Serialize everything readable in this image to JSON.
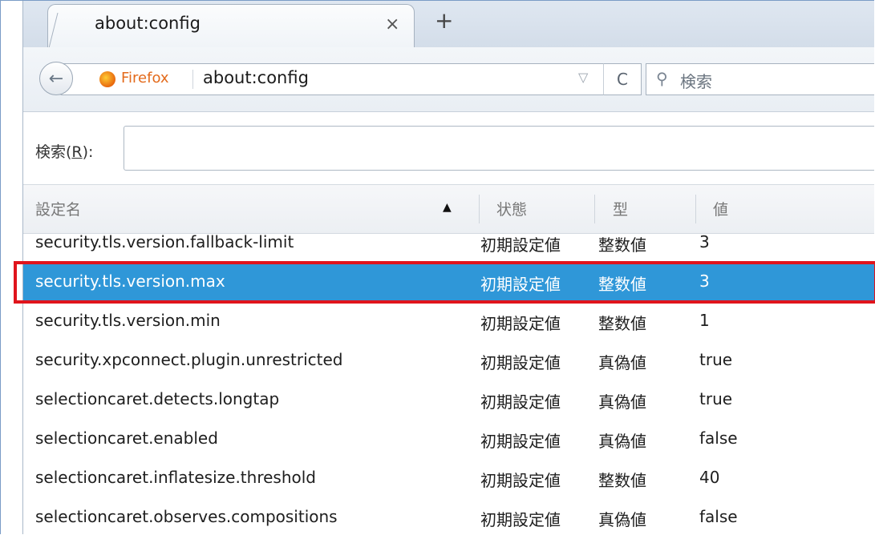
{
  "tab": {
    "title": "about:config",
    "close_glyph": "×",
    "new_tab_glyph": "+"
  },
  "navbar": {
    "back_glyph": "←",
    "identity_label": "Firefox",
    "url": "about:config",
    "dropmarker_glyph": "▽",
    "reload_glyph": "C",
    "search_placeholder": "検索",
    "search_glyph": "⚲"
  },
  "config_search": {
    "label_prefix": "検索(",
    "label_key": "R",
    "label_suffix": "):",
    "value": ""
  },
  "table": {
    "headers": {
      "name": "設定名",
      "status": "状態",
      "type": "型",
      "value": "値"
    },
    "sort_glyph": "▲",
    "rows": [
      {
        "name": "security.tls.version.fallback-limit",
        "status": "初期設定値",
        "type": "整数値",
        "value": "3"
      },
      {
        "name": "security.tls.version.max",
        "status": "初期設定値",
        "type": "整数値",
        "value": "3"
      },
      {
        "name": "security.tls.version.min",
        "status": "初期設定値",
        "type": "整数値",
        "value": "1"
      },
      {
        "name": "security.xpconnect.plugin.unrestricted",
        "status": "初期設定値",
        "type": "真偽値",
        "value": "true"
      },
      {
        "name": "selectioncaret.detects.longtap",
        "status": "初期設定値",
        "type": "真偽値",
        "value": "true"
      },
      {
        "name": "selectioncaret.enabled",
        "status": "初期設定値",
        "type": "真偽値",
        "value": "false"
      },
      {
        "name": "selectioncaret.inflatesize.threshold",
        "status": "初期設定値",
        "type": "整数値",
        "value": "40"
      },
      {
        "name": "selectioncaret.observes.compositions",
        "status": "初期設定値",
        "type": "真偽値",
        "value": "false"
      }
    ],
    "selected_row_index": 1
  },
  "colors": {
    "selection": "#2f97d8",
    "highlight_border": "#e0141c",
    "firefox_orange": "#e36a1b"
  },
  "icons": {
    "back": "back-arrow-icon",
    "identity": "firefox-logo-icon",
    "reload": "reload-icon",
    "search": "magnifier-icon",
    "sort": "sort-ascending-icon"
  }
}
